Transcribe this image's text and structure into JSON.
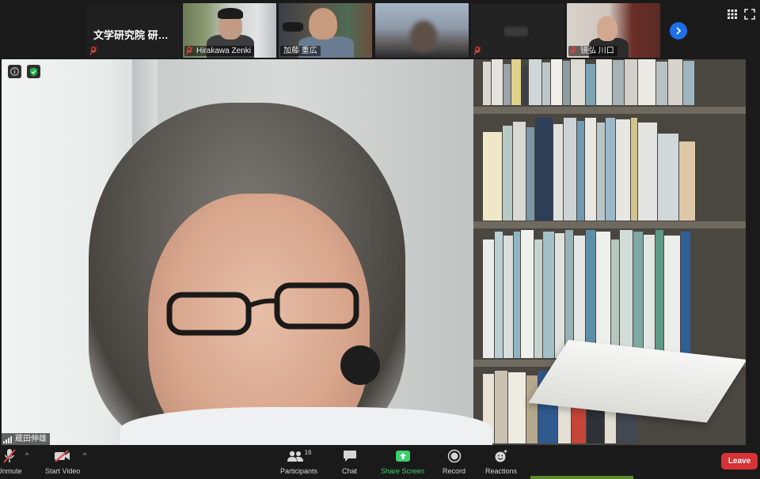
{
  "gallery": {
    "tiles": [
      {
        "name": "文学研究院 研…",
        "muted": true
      },
      {
        "name": "Hirakawa Zenki",
        "muted": true
      },
      {
        "name": "加藤 重広",
        "muted": false
      },
      {
        "name": "",
        "muted": false
      },
      {
        "name": "",
        "muted": true
      },
      {
        "name": "镜弘 川口",
        "muted": true
      }
    ]
  },
  "main_video": {
    "speaker_name": "蔵田伸雄"
  },
  "toolbar": {
    "unmute_label": "Unmute",
    "start_video_label": "Start Video",
    "participants_label": "Participants",
    "participants_count": "16",
    "chat_label": "Chat",
    "share_screen_label": "Share Screen",
    "record_label": "Record",
    "reactions_label": "Reactions",
    "leave_label": "Leave"
  },
  "colors": {
    "accent_blue": "#1c6fe8",
    "share_green": "#3ad26c",
    "leave_red": "#d73236",
    "mute_red": "#e0443e"
  }
}
